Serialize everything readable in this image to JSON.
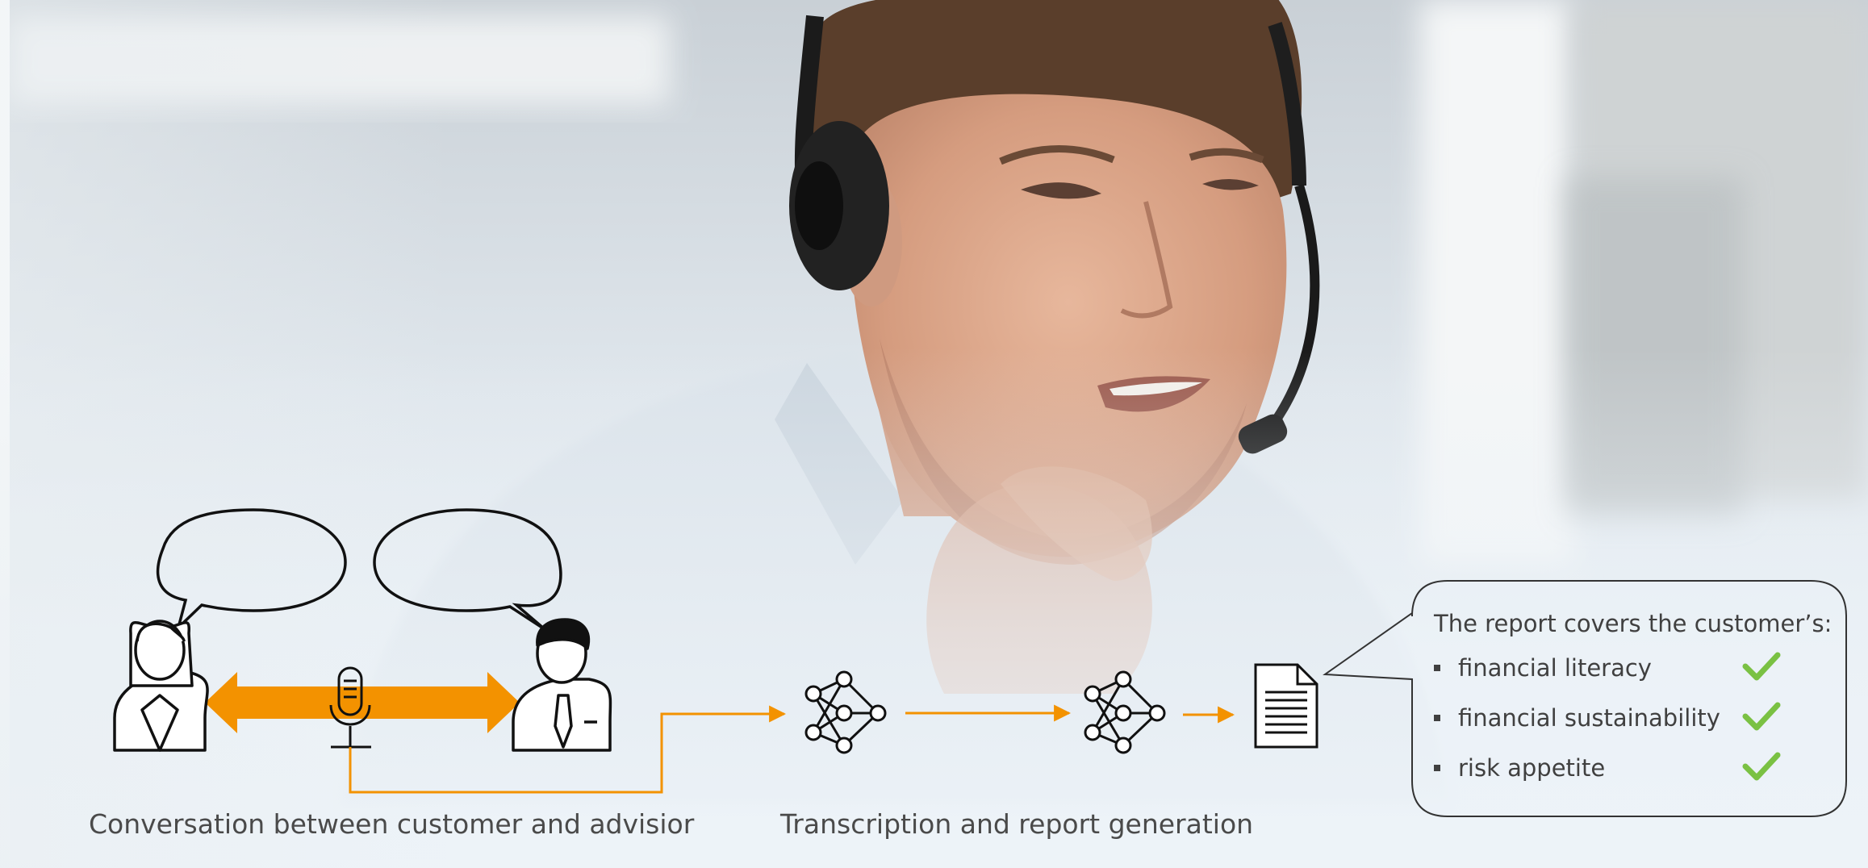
{
  "figure": {
    "photo": "call-center-advisor-with-headset",
    "colors": {
      "accent": "#f39200",
      "check": "#7ac143",
      "stroke": "#111111",
      "text": "#404040"
    }
  },
  "captions": {
    "conversation": "Conversation between customer and advisior",
    "processing": "Transcription and report generation"
  },
  "report": {
    "title": "The report covers the customer’s:",
    "items": [
      {
        "label": "financial literacy",
        "icon": "check-icon"
      },
      {
        "label": "financial sustainability",
        "icon": "check-icon"
      },
      {
        "label": "risk appetite",
        "icon": "check-icon"
      }
    ]
  },
  "icons": [
    "speech-bubble-icon",
    "customer-woman-icon",
    "advisor-man-icon",
    "microphone-icon",
    "neural-network-icon",
    "document-icon",
    "double-arrow-icon"
  ]
}
